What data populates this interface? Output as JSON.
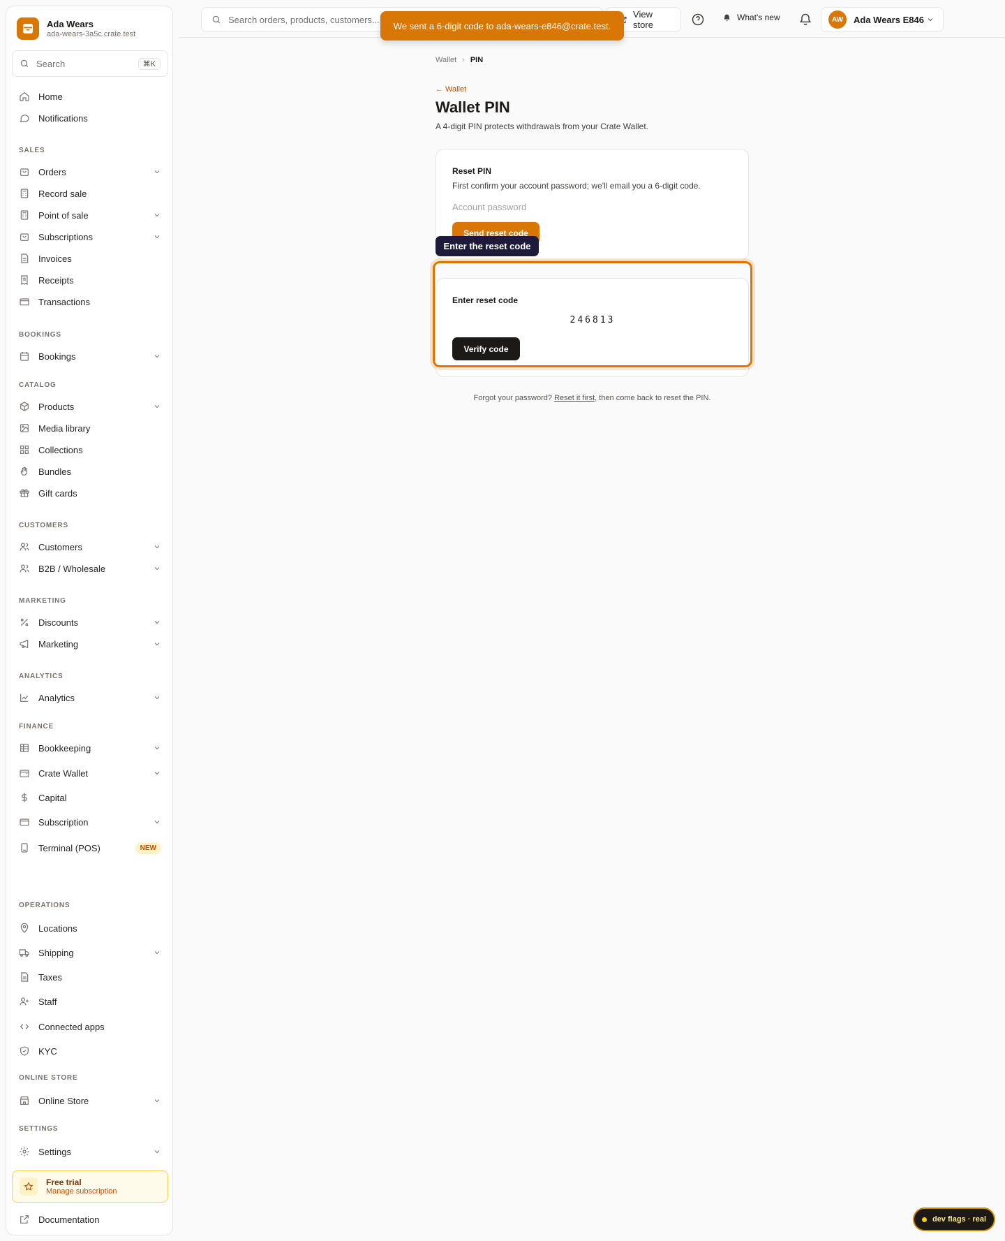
{
  "store": {
    "name": "Ada Wears",
    "domain": "ada-wears-3a5c.crate.test"
  },
  "sidebar": {
    "search_label": "Search",
    "search_shortcut": "⌘K",
    "items": {
      "home": "Home",
      "notifications": "Notifications",
      "orders": "Orders",
      "record_sale": "Record sale",
      "point_of_sale": "Point of sale",
      "subscriptions": "Subscriptions",
      "invoices": "Invoices",
      "receipts": "Receipts",
      "transactions": "Transactions",
      "bookings": "Bookings",
      "products": "Products",
      "media_library": "Media library",
      "collections": "Collections",
      "bundles": "Bundles",
      "gift_cards": "Gift cards",
      "customers": "Customers",
      "b2b": "B2B / Wholesale",
      "discounts": "Discounts",
      "marketing": "Marketing",
      "analytics": "Analytics",
      "bookkeeping": "Bookkeeping",
      "crate_wallet": "Crate Wallet",
      "capital": "Capital",
      "subscription": "Subscription",
      "terminal": "Terminal (POS)",
      "locations": "Locations",
      "shipping": "Shipping",
      "taxes": "Taxes",
      "staff": "Staff",
      "connected_apps": "Connected apps",
      "kyc": "KYC",
      "online_store": "Online Store",
      "settings": "Settings",
      "documentation": "Documentation"
    },
    "badge_new": "NEW",
    "sections": {
      "sales": "SALES",
      "bookings": "BOOKINGS",
      "catalog": "CATALOG",
      "customers": "CUSTOMERS",
      "marketing": "MARKETING",
      "analytics": "ANALYTICS",
      "finance": "FINANCE",
      "operations": "OPERATIONS",
      "online_store": "ONLINE STORE",
      "settings": "SETTINGS"
    },
    "trial": {
      "title": "Free trial",
      "subtitle": "Manage subscription"
    }
  },
  "topbar": {
    "search_placeholder": "Search orders, products, customers...",
    "view_store": "View store",
    "whats_new": "What's new",
    "account_initials": "AW",
    "account_name": "Ada Wears E846"
  },
  "toast": {
    "message": "We sent a 6-digit code to ada-wears-e846@crate.test."
  },
  "breadcrumb": {
    "parent": "Wallet",
    "current": "PIN"
  },
  "page": {
    "back_label": "← Wallet",
    "title": "Wallet PIN",
    "description": "A 4-digit PIN protects withdrawals from your Crate Wallet."
  },
  "reset_card": {
    "title": "Reset PIN",
    "description": "First confirm your account password; we'll email you a 6-digit code.",
    "password_placeholder": "Account password",
    "send_button": "Send reset code"
  },
  "coachmark": {
    "label": "Enter the reset code"
  },
  "code_card": {
    "title": "Enter reset code",
    "code_value": "246813",
    "verify_button": "Verify code"
  },
  "footnote": {
    "before": "Forgot your password? ",
    "link": "Reset it first",
    "after": ", then come back to reset the PIN."
  },
  "dev_flags": {
    "label": "dev flags · real"
  },
  "colors": {
    "accent": "#d97706",
    "dark": "#1c1917",
    "coach": "#1e1b3a"
  }
}
